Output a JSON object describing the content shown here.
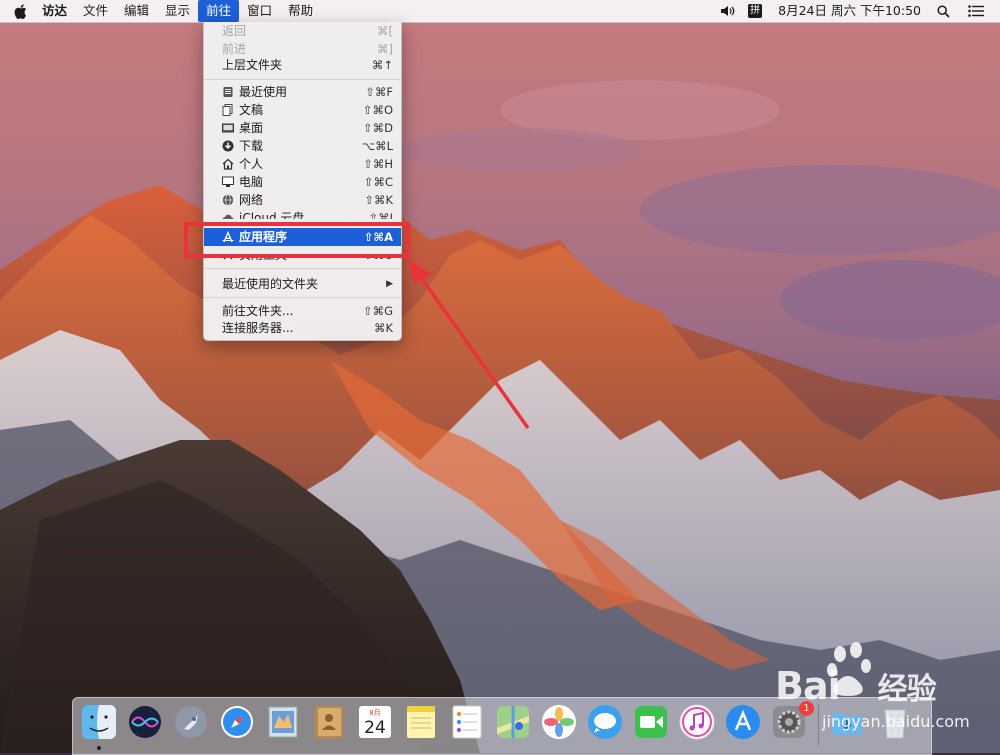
{
  "menubar": {
    "items": [
      {
        "label": "访达",
        "bold": true
      },
      {
        "label": "文件"
      },
      {
        "label": "编辑"
      },
      {
        "label": "显示"
      },
      {
        "label": "前往",
        "active": true
      },
      {
        "label": "窗口"
      },
      {
        "label": "帮助"
      }
    ],
    "datetime": "8月24日 周六 下午10:50",
    "input_method": "拼"
  },
  "go_menu": {
    "items": [
      {
        "label": "返回",
        "shortcut": "⌘[",
        "disabled": true
      },
      {
        "label": "前进",
        "shortcut": "⌘]",
        "disabled": true
      },
      {
        "label": "上层文件夹",
        "shortcut": "⌘↑"
      },
      {
        "label": "最近使用",
        "shortcut": "⇧⌘F",
        "icon": "recents-icon"
      },
      {
        "label": "文稿",
        "shortcut": "⇧⌘O",
        "icon": "documents-icon"
      },
      {
        "label": "桌面",
        "shortcut": "⇧⌘D",
        "icon": "desktop-icon"
      },
      {
        "label": "下载",
        "shortcut": "⌥⌘L",
        "icon": "downloads-icon"
      },
      {
        "label": "个人",
        "shortcut": "⇧⌘H",
        "icon": "home-icon"
      },
      {
        "label": "电脑",
        "shortcut": "⇧⌘C",
        "icon": "computer-icon"
      },
      {
        "label": "网络",
        "shortcut": "⇧⌘K",
        "icon": "network-icon"
      },
      {
        "label": "iCloud 云盘",
        "shortcut": "⇧⌘I",
        "icon": "icloud-icon"
      },
      {
        "label": "应用程序",
        "shortcut": "⇧⌘A",
        "icon": "applications-icon",
        "selected": true
      },
      {
        "label": "实用工具",
        "shortcut": "⇧⌘U",
        "icon": "utilities-icon"
      },
      {
        "label": "最近使用的文件夹",
        "submenu": true
      },
      {
        "label": "前往文件夹...",
        "shortcut": "⇧⌘G"
      },
      {
        "label": "连接服务器...",
        "shortcut": "⌘K"
      }
    ]
  },
  "dock": {
    "apps": [
      {
        "name": "访达",
        "icon": "finder-icon",
        "running": true
      },
      {
        "name": "Siri",
        "icon": "siri-icon"
      },
      {
        "name": "启动台",
        "icon": "launchpad-icon"
      },
      {
        "name": "Safari",
        "icon": "safari-icon"
      },
      {
        "name": "邮件",
        "icon": "mail-icon"
      },
      {
        "name": "通讯录",
        "icon": "contacts-icon"
      },
      {
        "name": "日历",
        "icon": "calendar-icon",
        "month": "8月",
        "day": "24"
      },
      {
        "name": "备忘录",
        "icon": "notes-icon"
      },
      {
        "name": "提醒事项",
        "icon": "reminders-icon"
      },
      {
        "name": "地图",
        "icon": "maps-icon"
      },
      {
        "name": "照片",
        "icon": "photos-icon"
      },
      {
        "name": "信息",
        "icon": "messages-icon"
      },
      {
        "name": "FaceTime",
        "icon": "facetime-icon"
      },
      {
        "name": "iTunes",
        "icon": "itunes-icon"
      },
      {
        "name": "App Store",
        "icon": "appstore-icon"
      },
      {
        "name": "系统偏好设置",
        "icon": "system-preferences-icon",
        "badge": "1"
      },
      {
        "name": "下载",
        "icon": "downloads-folder-icon"
      },
      {
        "name": "废纸篓",
        "icon": "trash-icon"
      }
    ]
  },
  "watermark": {
    "brand": "Bai",
    "cn": "经验",
    "url": "jingyan.baidu.com"
  },
  "colors": {
    "selection": "#1d5fd8",
    "annotation": "#e8323c"
  }
}
